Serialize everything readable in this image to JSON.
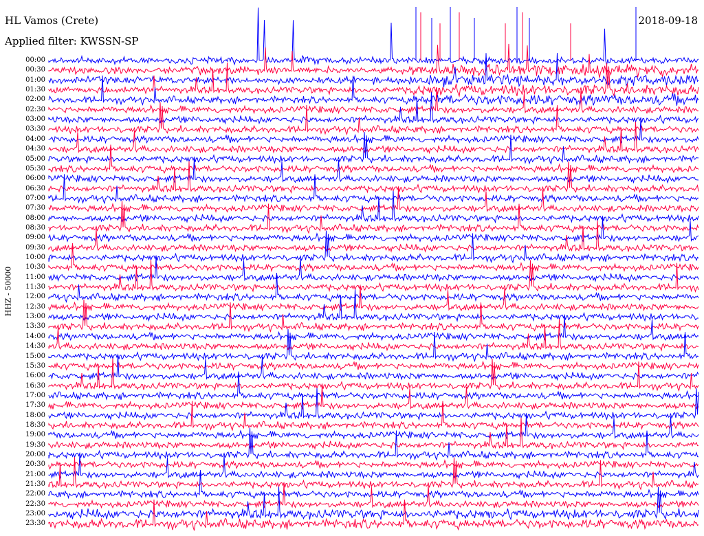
{
  "header": {
    "station": "HL Vamos (Crete)",
    "filter": "Applied filter: KWSSN-SP",
    "date": "2018-09-18"
  },
  "channel_label": "HHZ - 50000",
  "colors": {
    "background": "#ffffff",
    "trace_a": "#0000ff",
    "trace_b": "#ff0040",
    "text": "#000000"
  },
  "chart_data": {
    "type": "line",
    "title": "HL Vamos (Crete)",
    "subtitle": "Applied filter: KWSSN-SP",
    "date": "2018-09-18",
    "ylabel": "HHZ - 50000",
    "row_labels": [
      "00:00",
      "00:30",
      "01:00",
      "01:30",
      "02:00",
      "02:30",
      "03:00",
      "03:30",
      "04:00",
      "04:30",
      "05:00",
      "05:30",
      "06:00",
      "06:30",
      "07:00",
      "07:30",
      "08:00",
      "08:30",
      "09:00",
      "09:30",
      "10:00",
      "10:30",
      "11:00",
      "11:30",
      "12:00",
      "12:30",
      "13:00",
      "13:30",
      "14:00",
      "14:30",
      "15:00",
      "15:30",
      "16:00",
      "16:30",
      "17:00",
      "17:30",
      "18:00",
      "18:30",
      "19:00",
      "19:30",
      "20:00",
      "20:30",
      "21:00",
      "21:30",
      "22:00",
      "22:30",
      "23:00",
      "23:30"
    ],
    "series": [
      {
        "color": "#0000ff"
      },
      {
        "color": "#ff0040"
      }
    ],
    "grid": false,
    "legend": "none"
  }
}
